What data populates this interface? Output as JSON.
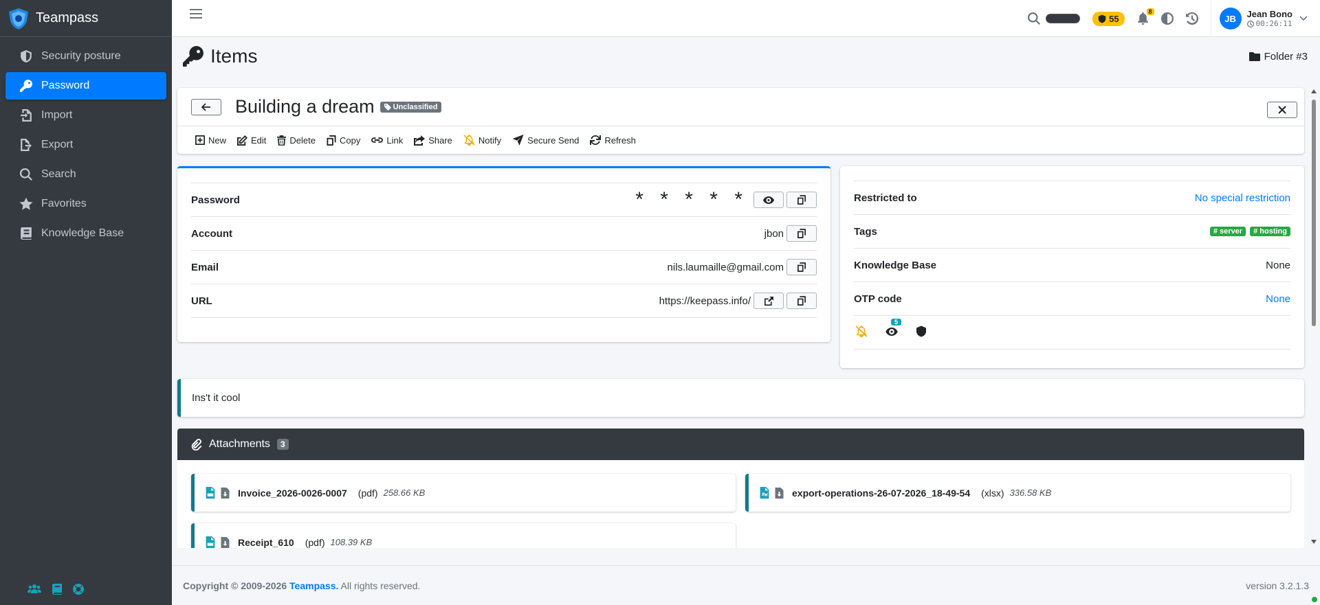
{
  "app": {
    "name": "Teampass",
    "brand_color": "#007bff",
    "sidebar_bg": "#343a40"
  },
  "sidebar": {
    "items": [
      {
        "label": "Security posture",
        "icon": "shield-icon"
      },
      {
        "label": "Password",
        "icon": "key-icon",
        "active": true
      },
      {
        "label": "Import",
        "icon": "file-import-icon"
      },
      {
        "label": "Export",
        "icon": "file-export-icon"
      },
      {
        "label": "Search",
        "icon": "search-icon"
      },
      {
        "label": "Favorites",
        "icon": "star-icon"
      },
      {
        "label": "Knowledge Base",
        "icon": "book-icon"
      }
    ],
    "bottom_icons": [
      "users-icon",
      "book-icon",
      "life-ring-icon"
    ]
  },
  "topbar": {
    "score": "55",
    "notifications": "8",
    "user": {
      "initials": "JB",
      "name": "Jean Bono",
      "timer": "00:26:11"
    }
  },
  "page": {
    "title": "Items",
    "folder": "Folder #3"
  },
  "item": {
    "title": "Building a dream",
    "classification": "Unclassified",
    "toolbar": [
      "New",
      "Edit",
      "Delete",
      "Copy",
      "Link",
      "Share",
      "Notify",
      "Secure Send",
      "Refresh"
    ],
    "fields": {
      "password": {
        "label": "Password",
        "value": "* * * * *"
      },
      "account": {
        "label": "Account",
        "value": "jbon"
      },
      "email": {
        "label": "Email",
        "value": "nils.laumaille@gmail.com"
      },
      "url": {
        "label": "URL",
        "value": "https://keepass.info/"
      }
    },
    "info": {
      "restricted": {
        "label": "Restricted to",
        "value": "No special restriction"
      },
      "tags": {
        "label": "Tags",
        "values": [
          "server",
          "hosting"
        ]
      },
      "kb": {
        "label": "Knowledge Base",
        "value": "None"
      },
      "otp": {
        "label": "OTP code",
        "value": "None"
      },
      "views": "5"
    },
    "description": "Ins't it cool"
  },
  "attachments": {
    "title": "Attachments",
    "count": "3",
    "files": [
      {
        "name": "Invoice_2026-0026-0007",
        "ext": "(pdf)",
        "size": "258.66 KB",
        "type": "pdf"
      },
      {
        "name": "export-operations-26-07-2026_18-49-54",
        "ext": "(xlsx)",
        "size": "336.58 KB",
        "type": "xlsx"
      },
      {
        "name": "Receipt_610",
        "ext": "(pdf)",
        "size": "108.39 KB",
        "type": "pdf"
      }
    ]
  },
  "footer": {
    "copyright": "Copyright © 2009-2026",
    "brand": "Teampass.",
    "rights": "All rights reserved.",
    "version": "version 3.2.1.3"
  }
}
